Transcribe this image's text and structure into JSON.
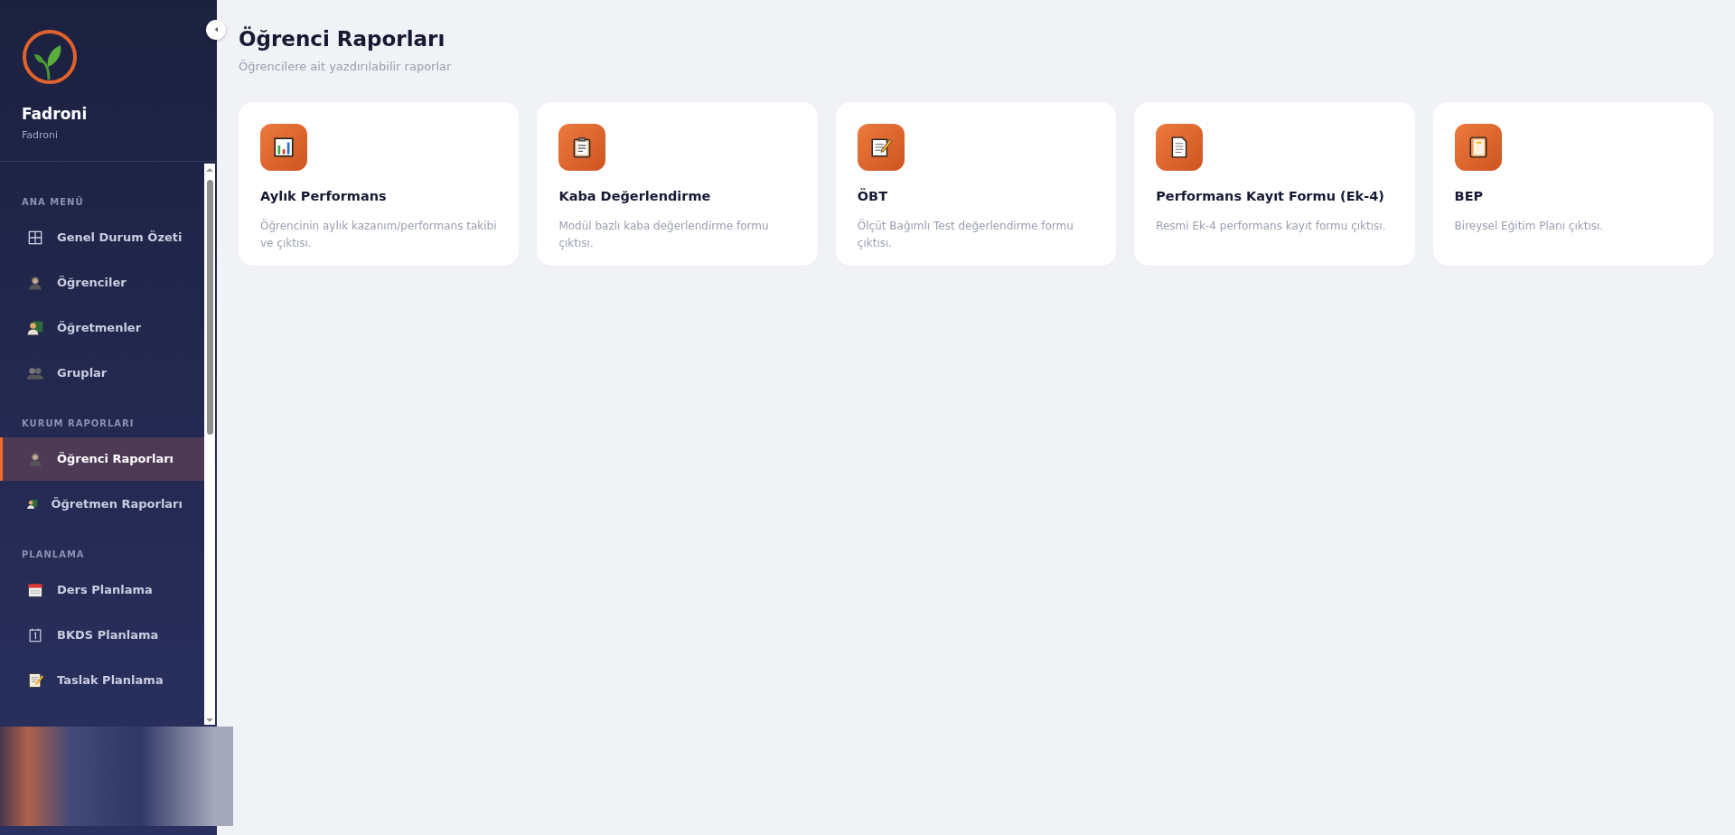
{
  "brand": {
    "name": "Fadroni",
    "subtitle": "Fadroni"
  },
  "sidebar": {
    "sections": [
      {
        "title": "ANA MENÜ",
        "items": [
          {
            "label": "Genel Durum Özeti",
            "selected": false
          },
          {
            "label": "Öğrenciler",
            "selected": false
          },
          {
            "label": "Öğretmenler",
            "selected": false
          },
          {
            "label": "Gruplar",
            "selected": false
          }
        ]
      },
      {
        "title": "KURUM RAPORLARI",
        "items": [
          {
            "label": "Öğrenci Raporları",
            "selected": true
          },
          {
            "label": "Öğretmen Raporları",
            "selected": false
          }
        ]
      },
      {
        "title": "PLANLAMA",
        "items": [
          {
            "label": "Ders Planlama",
            "selected": false
          },
          {
            "label": "BKDS Planlama",
            "selected": false
          },
          {
            "label": "Taslak Planlama",
            "selected": false
          }
        ]
      }
    ]
  },
  "page": {
    "title": "Öğrenci Raporları",
    "subtitle": "Öğrencilere ait yazdırılabilir raporlar"
  },
  "cards": [
    {
      "title": "Aylık Performans",
      "description": "Öğrencinin aylık kazanım/performans takibi ve çıktısı."
    },
    {
      "title": "Kaba Değerlendirme",
      "description": "Modül bazlı kaba değerlendirme formu çıktısı."
    },
    {
      "title": "ÖBT",
      "description": "Ölçüt Bağımlı Test değerlendirme formu çıktısı."
    },
    {
      "title": "Performans Kayıt Formu (Ek-4)",
      "description": "Resmi Ek-4 performans kayıt formu çıktısı."
    },
    {
      "title": "BEP",
      "description": "Bireysel Eğitim Planı çıktısı."
    }
  ]
}
